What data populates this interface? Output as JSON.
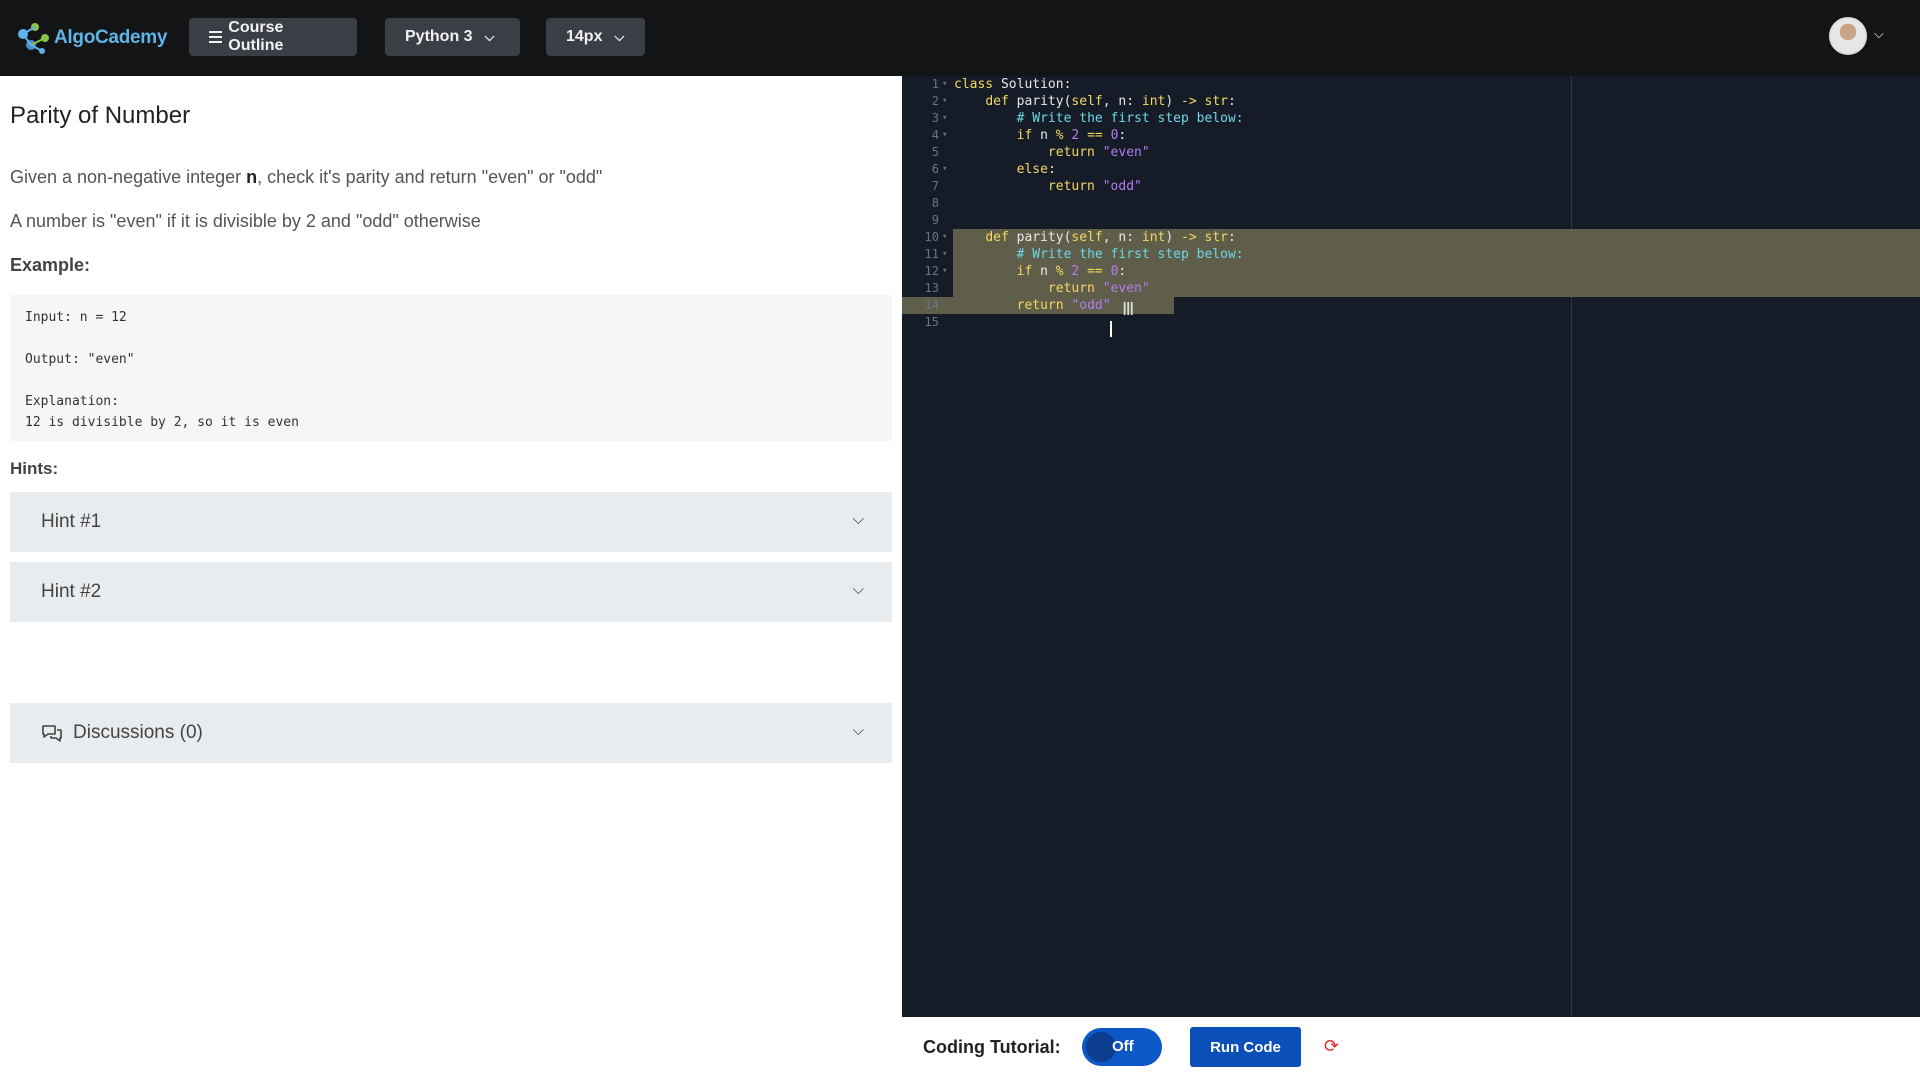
{
  "topbar": {
    "logo_text": "AlgoCadem",
    "logo_suffix": "y",
    "course_outline_label": "Course Outline",
    "language_label": "Python 3",
    "font_size_label": "14px"
  },
  "problem": {
    "title": "Parity of Number",
    "desc_pre": "Given a non-negative integer ",
    "desc_var": "n",
    "desc_post": ", check it's parity and return \"even\" or \"odd\"",
    "desc2": "A number is \"even\" if it is divisible by 2 and \"odd\" otherwise",
    "example_label": "Example:",
    "example": {
      "input": "Input: n = 12",
      "output": "Output: \"even\"",
      "explanation_label": "Explanation:",
      "explanation": "12 is divisible by 2, so it is even"
    },
    "hints_label": "Hints:",
    "hints": [
      "Hint #1",
      "Hint #2"
    ],
    "discussions_label": "Discussions (0)"
  },
  "editor": {
    "line_numbers": [
      "1",
      "2",
      "3",
      "4",
      "5",
      "6",
      "7",
      "8",
      "9",
      "10",
      "11",
      "12",
      "13",
      "14",
      "15"
    ],
    "folds": [
      true,
      true,
      true,
      true,
      false,
      true,
      false,
      false,
      false,
      true,
      true,
      true,
      false,
      false,
      false
    ]
  },
  "bottombar": {
    "tutorial_label": "Coding Tutorial:",
    "toggle_label": "Off",
    "run_label": "Run Code"
  }
}
